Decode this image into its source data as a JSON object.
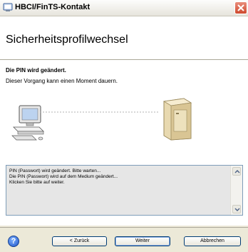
{
  "window": {
    "title": "HBCI/FinTS-Kontakt",
    "close_icon": "close-icon",
    "app_icon": "hbci-app-icon"
  },
  "header": {
    "title": "Sicherheitsprofilwechsel"
  },
  "step": {
    "title": "Die PIN wird geändert.",
    "description": "Dieser Vorgang kann einen Moment dauern."
  },
  "illustration": {
    "left_icon": "computer-icon",
    "right_icon": "server-icon"
  },
  "log": {
    "lines": [
      "PIN (Passwort) wird geändert. Bitte warten...",
      "Die PIN (Passwort) wird auf dem Medium geändert...",
      "Klicken Sie bitte auf weiter."
    ]
  },
  "footer": {
    "help_icon": "help-icon",
    "help_glyph": "?",
    "back_label": "< Zurück",
    "next_label": "Weiter",
    "cancel_label": "Abbrechen"
  }
}
